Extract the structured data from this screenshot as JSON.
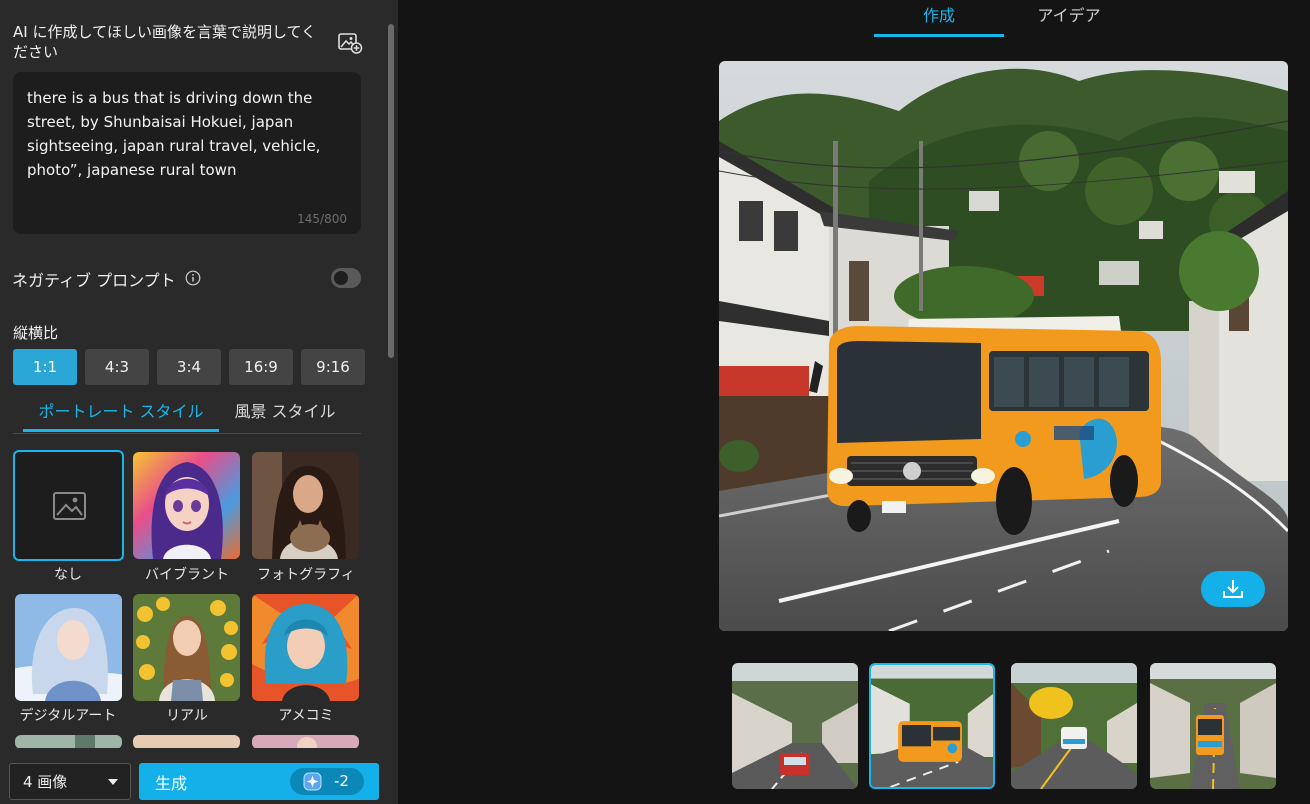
{
  "prompt": {
    "heading": "AI に作成してほしい画像を言葉で説明してください",
    "text": "there is a bus that is driving down the street, by Shunbaisai Hokuei, japan sightseeing, japan rural travel, vehicle, photo”, japanese rural town",
    "char_count": "145/800"
  },
  "negative_prompt": {
    "label": "ネガティブ プロンプト",
    "enabled": false
  },
  "aspect": {
    "label": "縦横比",
    "options": [
      "1:1",
      "4:3",
      "3:4",
      "16:9",
      "9:16"
    ],
    "selected": "1:1"
  },
  "style_tabs": {
    "portrait": "ポートレート スタイル",
    "landscape": "風景 スタイル"
  },
  "styles": [
    {
      "label": "なし"
    },
    {
      "label": "バイブラント"
    },
    {
      "label": "フォトグラフィ"
    },
    {
      "label": "デジタルアート"
    },
    {
      "label": "リアル"
    },
    {
      "label": "アメコミ"
    }
  ],
  "bottom": {
    "count": "4 画像",
    "generate": "生成",
    "cost": "-2"
  },
  "top_tabs": {
    "create": "作成",
    "idea": "アイデア"
  },
  "colors": {
    "accent": "#19b6ec",
    "panel": "#2a2a2a",
    "background": "#141414"
  }
}
